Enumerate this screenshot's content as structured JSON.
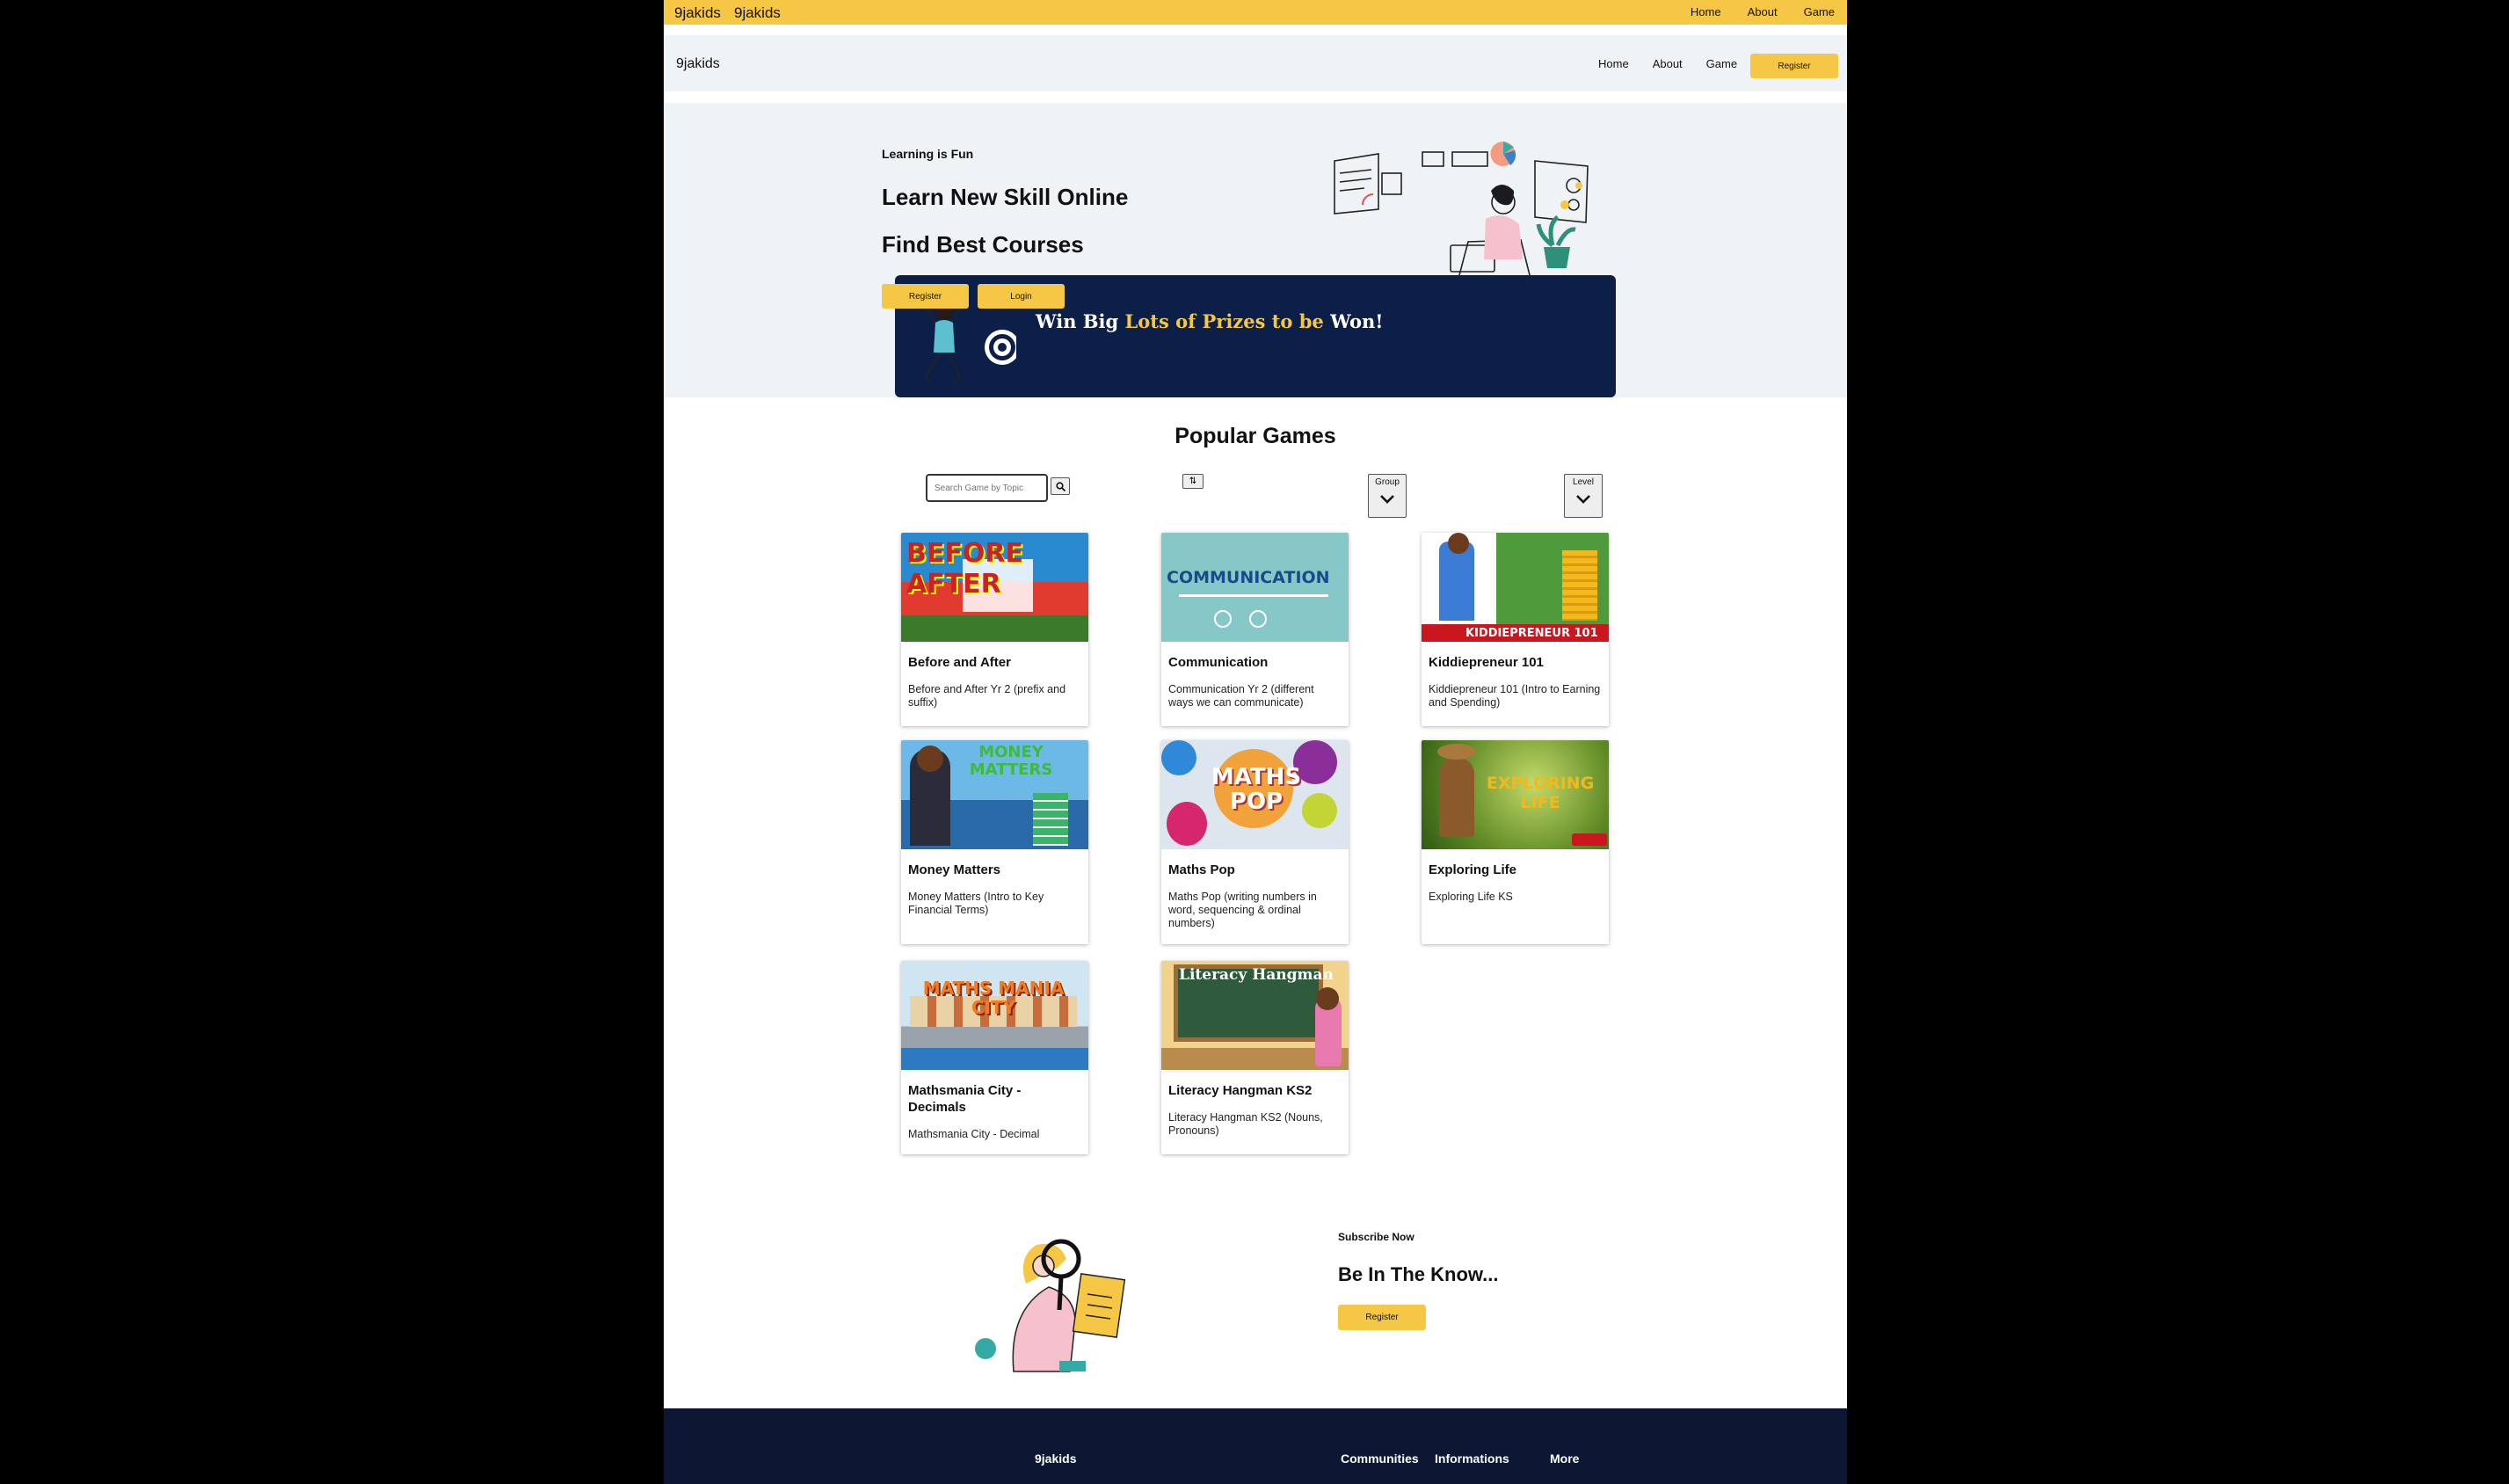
{
  "topbar": {
    "brand1": "9jakids",
    "brand2": "9jakids",
    "nav": [
      "Home",
      "About",
      "Game"
    ]
  },
  "header": {
    "brand": "9jakids",
    "nav": [
      "Home",
      "About",
      "Game"
    ],
    "register": "Register"
  },
  "hero": {
    "tagline": "Learning is Fun",
    "headline1": "Learn New Skill Online",
    "headline2": "Find Best Courses",
    "register": "Register",
    "login": "Login",
    "banner_a": "Win Big ",
    "banner_hl": "Lots of Prizes to be",
    "banner_b": " Won!"
  },
  "games": {
    "title": "Popular Games",
    "search_placeholder": "Search Game by Topic",
    "group_label": "Group",
    "level_label": "Level",
    "items": [
      {
        "title": "Before and After",
        "desc": "Before and After Yr 2 (prefix and suffix)",
        "thumb_text": "BEFORE AFTER"
      },
      {
        "title": "Communication",
        "desc": "Communication Yr 2 (different ways we can communicate)",
        "thumb_text": "COMMUNICATION"
      },
      {
        "title": "Kiddiepreneur 101",
        "desc": "Kiddiepreneur 101 (Intro to Earning and Spending)",
        "thumb_text": "KIDDIEPRENEUR 101"
      },
      {
        "title": "Money Matters",
        "desc": "Money Matters (Intro to Key Financial Terms)",
        "thumb_text": "MONEY MATTERS"
      },
      {
        "title": "Maths Pop",
        "desc": "Maths Pop (writing numbers in word, sequencing & ordinal numbers)",
        "thumb_text": "MATHS POP"
      },
      {
        "title": "Exploring Life",
        "desc": "Exploring Life KS",
        "thumb_text": "EXPLORING LIFE"
      },
      {
        "title": "Mathsmania City - Decimals",
        "desc": "Mathsmania City - Decimal",
        "thumb_text": "MATHS MANIA CITY"
      },
      {
        "title": "Literacy Hangman KS2",
        "desc": "Literacy Hangman KS2 (Nouns, Pronouns)",
        "thumb_text": "Literacy Hangman"
      }
    ]
  },
  "subscribe": {
    "tag": "Subscribe Now",
    "headline": "Be In The Know...",
    "register": "Register"
  },
  "footer": {
    "brand": "9jakids",
    "col1": "Communities",
    "col2": "Informations",
    "col3": "More"
  },
  "colors": {
    "accent": "#f6c744",
    "navy": "#0c1f48",
    "footer": "#0b1733",
    "hero_bg": "#eff3f6"
  }
}
